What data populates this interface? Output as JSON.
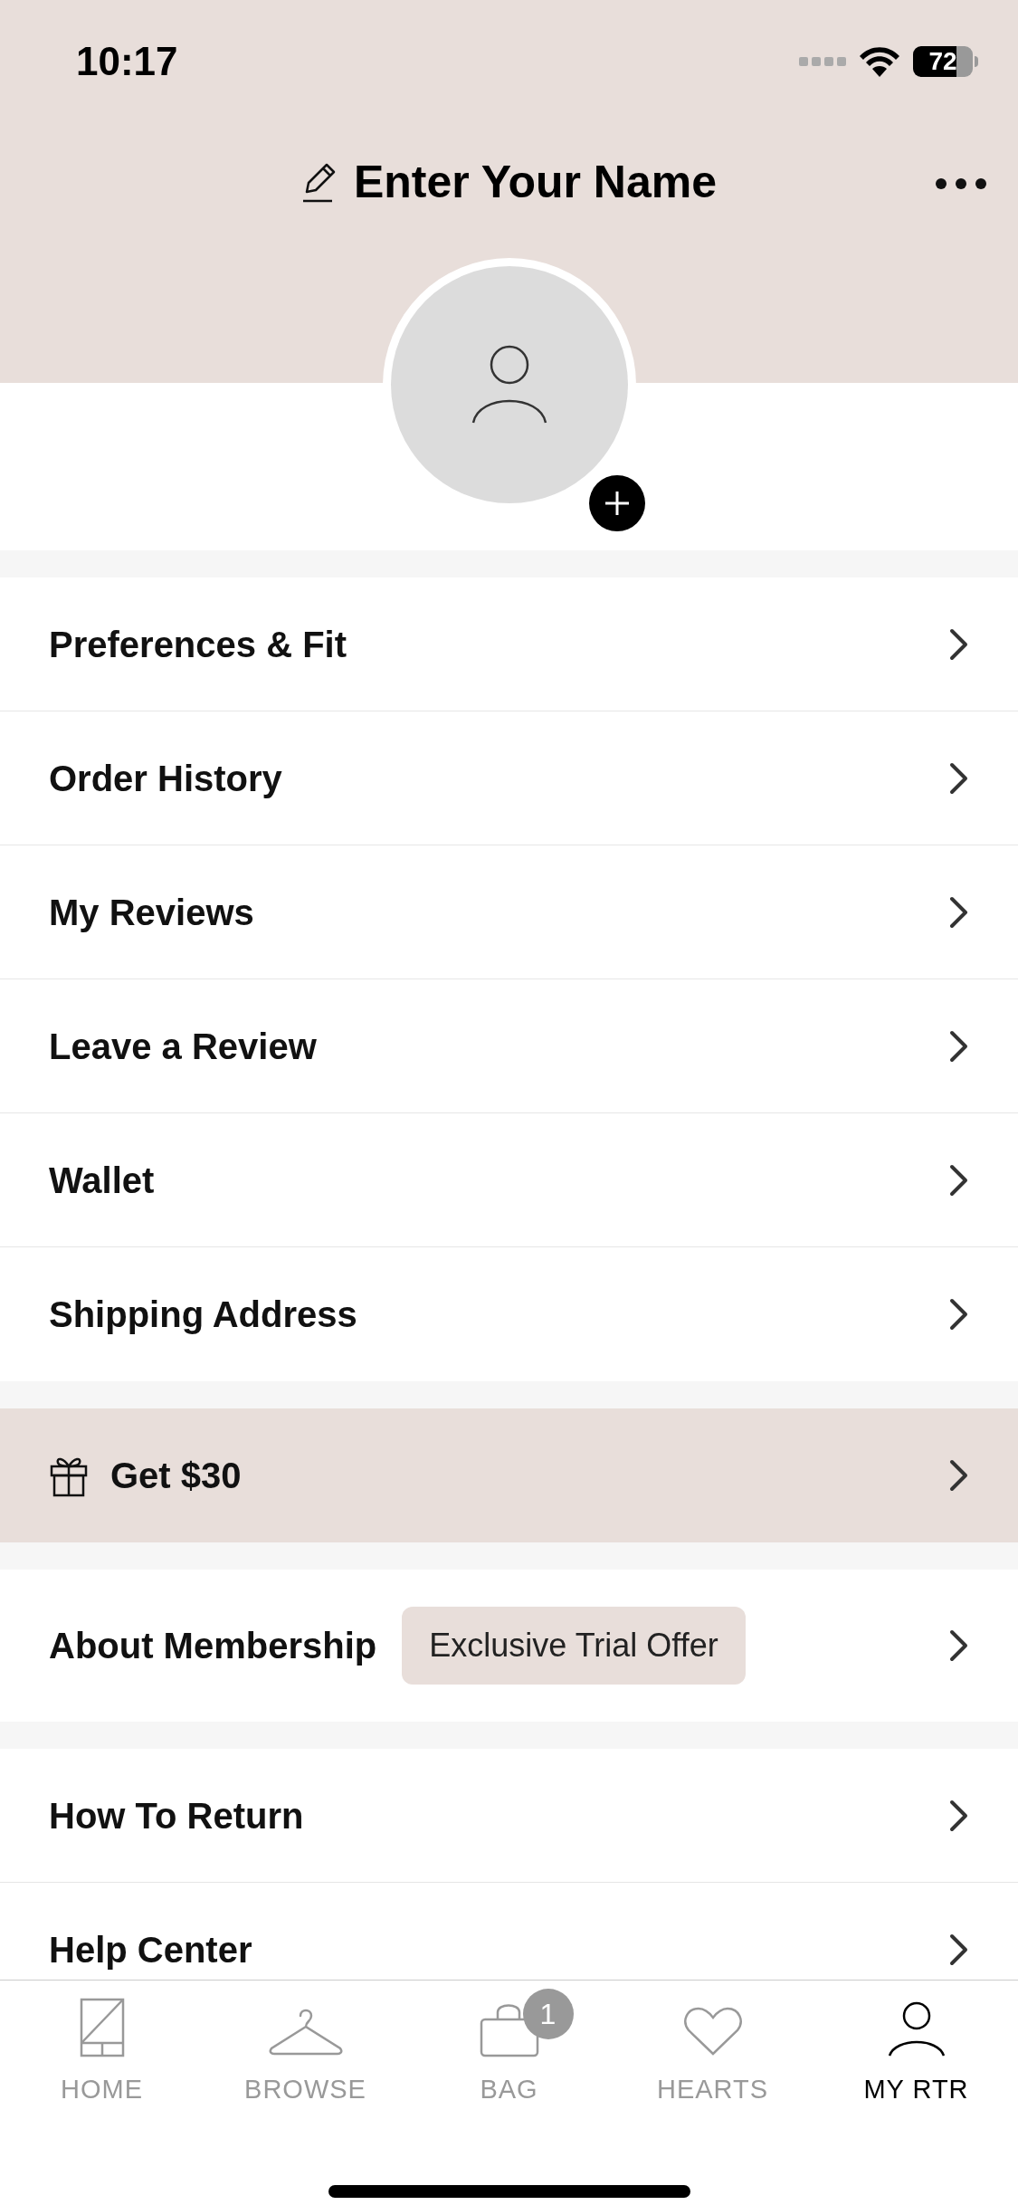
{
  "status_bar": {
    "time": "10:17",
    "battery": "72"
  },
  "header": {
    "title": "Enter Your Name"
  },
  "menu_groups": [
    {
      "kind": "plain",
      "items": [
        {
          "label": "Preferences & Fit"
        },
        {
          "label": "Order History"
        },
        {
          "label": "My Reviews"
        },
        {
          "label": "Leave a Review"
        },
        {
          "label": "Wallet"
        },
        {
          "label": "Shipping Address"
        }
      ]
    },
    {
      "kind": "promo",
      "items": [
        {
          "label": "Get $30"
        }
      ]
    },
    {
      "kind": "plain",
      "items": [
        {
          "label": "About Membership",
          "badge": "Exclusive Trial Offer"
        }
      ]
    },
    {
      "kind": "plain",
      "items": [
        {
          "label": "How To Return"
        },
        {
          "label": "Help Center"
        }
      ]
    }
  ],
  "tab_bar": [
    {
      "kind": "home",
      "label": "HOME",
      "selected": false
    },
    {
      "kind": "browse",
      "label": "BROWSE",
      "selected": false
    },
    {
      "kind": "bag",
      "label": "BAG",
      "selected": false,
      "badge": "1"
    },
    {
      "kind": "hearts",
      "label": "HEARTS",
      "selected": false
    },
    {
      "kind": "profile",
      "label": "MY RTR",
      "selected": true
    }
  ]
}
